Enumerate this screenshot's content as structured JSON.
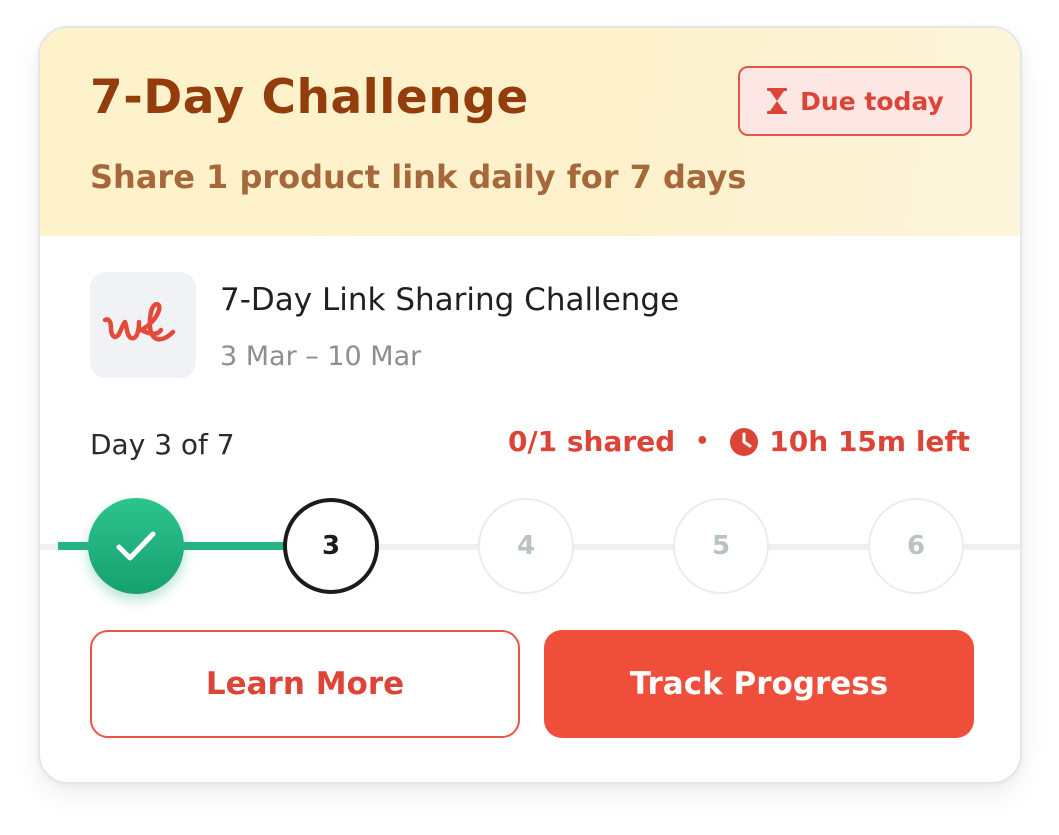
{
  "header": {
    "title": "7-Day Challenge",
    "subtitle": "Share 1 product link daily for 7 days",
    "badge": {
      "icon": "hourglass-icon",
      "label": "Due today"
    }
  },
  "challenge": {
    "logo_icon": "wl-logo",
    "name": "7-Day Link Sharing Challenge",
    "dates": "3 Mar – 10 Mar"
  },
  "progress": {
    "day_label": "Day 3 of 7",
    "shared": "0/1 shared",
    "separator": "•",
    "time_icon": "clock-icon",
    "time_left": "10h 15m left",
    "steps": [
      {
        "label": "",
        "state": "completed",
        "icon": "check-icon"
      },
      {
        "label": "3",
        "state": "current"
      },
      {
        "label": "4",
        "state": "upcoming"
      },
      {
        "label": "5",
        "state": "upcoming"
      },
      {
        "label": "6",
        "state": "upcoming"
      }
    ]
  },
  "actions": {
    "learn_more": "Learn More",
    "track_progress": "Track Progress"
  },
  "colors": {
    "brand_red": "#EE4E3A",
    "title_brown": "#933C0C",
    "success_green": "#27B483"
  }
}
